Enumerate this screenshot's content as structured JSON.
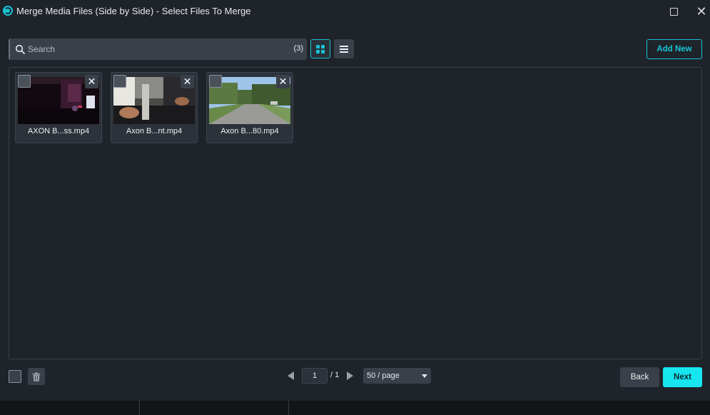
{
  "window": {
    "title": "Merge Media Files (Side by Side) - Select Files To Merge",
    "app_icon": "app-logo-icon",
    "maximize_icon": "maximize-icon",
    "close_glyph": "✕"
  },
  "toolbar": {
    "search_placeholder": "Search",
    "search_count": "(3)",
    "grid_view_icon": "grid-view-icon",
    "list_view_icon": "list-view-icon",
    "add_new_label": "Add New"
  },
  "media_files": [
    {
      "name": "AXON B...ss.mp4",
      "selected": false
    },
    {
      "name": "Axon B...nt.mp4",
      "selected": false
    },
    {
      "name": "Axon B...80.mp4",
      "selected": false
    }
  ],
  "remove_glyph": "✕",
  "footer": {
    "page_current": "1",
    "page_total": "/ 1",
    "per_page": "50 / page",
    "back_label": "Back",
    "next_label": "Next"
  },
  "colors": {
    "accent": "#17c3d6",
    "next_button": "#16e6f0",
    "background": "#1f232a",
    "control": "#3a4049"
  }
}
